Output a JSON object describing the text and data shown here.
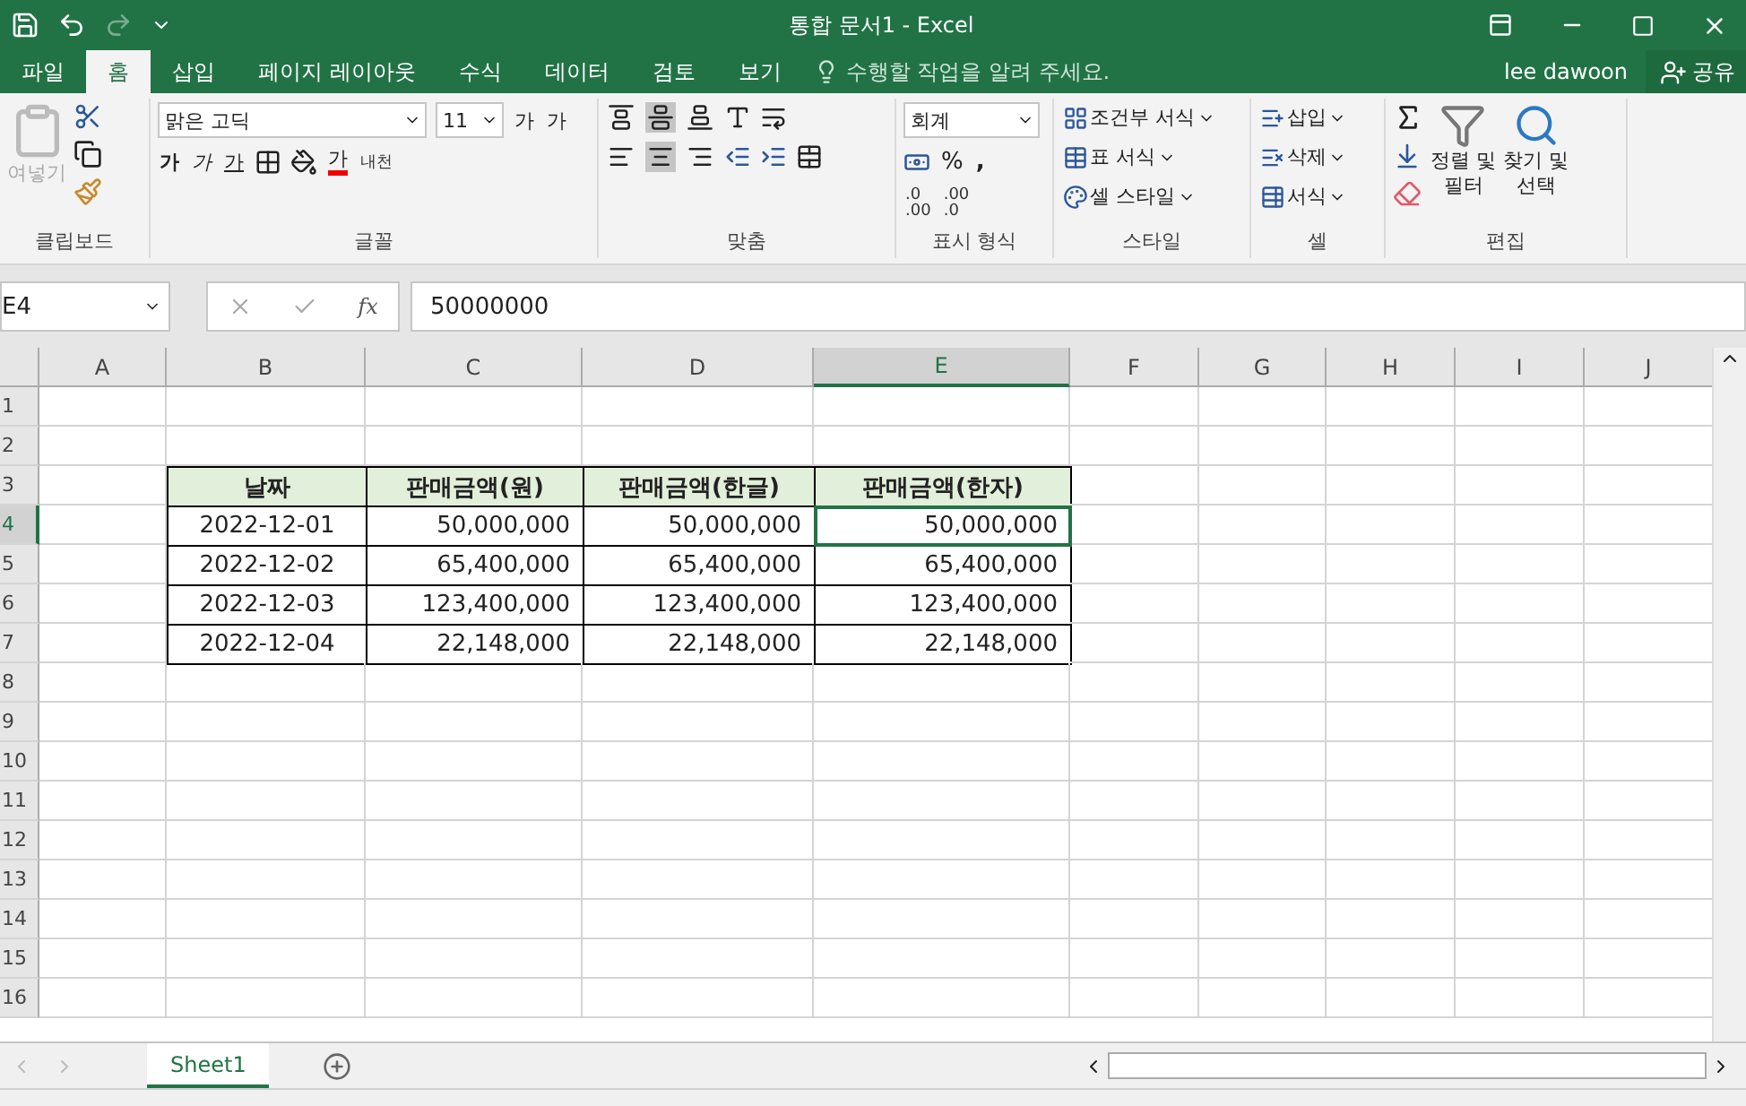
{
  "title_bar": {
    "title": "통합 문서1 - Excel",
    "redo_disabled": true
  },
  "menu_tabs": [
    {
      "label": "파일",
      "selected": false
    },
    {
      "label": "홈",
      "selected": true
    },
    {
      "label": "삽입",
      "selected": false
    },
    {
      "label": "페이지 레이아웃",
      "selected": false
    },
    {
      "label": "수식",
      "selected": false
    },
    {
      "label": "데이터",
      "selected": false
    },
    {
      "label": "검토",
      "selected": false
    },
    {
      "label": "보기",
      "selected": false
    }
  ],
  "tell_me": {
    "placeholder": "수행할 작업을 알려 주세요."
  },
  "user": "lee dawoon",
  "share": "공유",
  "ribbon": {
    "clipboard": {
      "paste": "여넣기",
      "label": "클립보드"
    },
    "font": {
      "label": "글꼴",
      "font_name": "맑은 고딕",
      "font_size": "11",
      "grow": "가",
      "shrink": "가",
      "bold": "가",
      "italic": "가",
      "underline": "가",
      "font_color": "가",
      "phonetic": "내천"
    },
    "alignment": {
      "label": "맞춤",
      "vertical": [
        {
          "selected": false
        },
        {
          "selected": true
        },
        {
          "selected": false
        }
      ],
      "horizontal": [
        {
          "selected": false
        },
        {
          "selected": true
        },
        {
          "selected": false
        }
      ]
    },
    "number": {
      "label": "표시 형식",
      "format": "회계",
      "percent": "%",
      "comma": ",",
      "decimals": [
        {
          "top": ".0",
          "bottom": ".00"
        },
        {
          "top": ".00",
          "bottom": ".0"
        }
      ]
    },
    "styles": {
      "label": "스타일",
      "items": [
        "조건부 서식",
        "표 서식",
        "셀 스타일"
      ]
    },
    "cells": {
      "label": "셀",
      "items": [
        "삽입",
        "삭제",
        "서식"
      ]
    },
    "editing": {
      "label": "편집",
      "sort": [
        "정렬 및",
        "필터"
      ],
      "find": [
        "찾기 및",
        "선택"
      ]
    }
  },
  "formula_bar": {
    "name_box": "E4",
    "fx": "fx",
    "value": "50000000"
  },
  "sheet": {
    "columns": [
      {
        "label": "A",
        "selected": false
      },
      {
        "label": "B",
        "selected": false
      },
      {
        "label": "C",
        "selected": false
      },
      {
        "label": "D",
        "selected": false
      },
      {
        "label": "E",
        "selected": true
      },
      {
        "label": "F",
        "selected": false
      },
      {
        "label": "G",
        "selected": false
      },
      {
        "label": "H",
        "selected": false
      },
      {
        "label": "I",
        "selected": false
      },
      {
        "label": "J",
        "selected": false
      }
    ],
    "rows": [
      {
        "label": "1",
        "selected": false,
        "cells": []
      },
      {
        "label": "2",
        "selected": false,
        "cells": []
      },
      {
        "label": "3",
        "selected": false,
        "cells": [
          {
            "text": ""
          },
          {
            "kind": "header",
            "text": "날짜",
            "selected": false
          },
          {
            "kind": "header",
            "text": "판매금액(원)",
            "selected": false
          },
          {
            "kind": "header",
            "text": "판매금액(한글)",
            "selected": false
          },
          {
            "kind": "header",
            "text": "판매금액(한자)",
            "selected": false
          }
        ]
      },
      {
        "label": "4",
        "selected": true,
        "cells": [
          {
            "text": ""
          },
          {
            "kind": "date",
            "text": "2022-12-01",
            "selected": false
          },
          {
            "kind": "number",
            "text": "50,000,000",
            "selected": false
          },
          {
            "kind": "number",
            "text": "50,000,000",
            "selected": false
          },
          {
            "kind": "number",
            "text": "50,000,000",
            "selected": true
          }
        ]
      },
      {
        "label": "5",
        "selected": false,
        "cells": [
          {
            "text": ""
          },
          {
            "kind": "date",
            "text": "2022-12-02",
            "selected": false
          },
          {
            "kind": "number",
            "text": "65,400,000",
            "selected": false
          },
          {
            "kind": "number",
            "text": "65,400,000",
            "selected": false
          },
          {
            "kind": "number",
            "text": "65,400,000",
            "selected": false
          }
        ]
      },
      {
        "label": "6",
        "selected": false,
        "cells": [
          {
            "text": ""
          },
          {
            "kind": "date",
            "text": "2022-12-03",
            "selected": false
          },
          {
            "kind": "number",
            "text": "123,400,000",
            "selected": false
          },
          {
            "kind": "number",
            "text": "123,400,000",
            "selected": false
          },
          {
            "kind": "number",
            "text": "123,400,000",
            "selected": false
          }
        ]
      },
      {
        "label": "7",
        "selected": false,
        "cells": [
          {
            "text": ""
          },
          {
            "kind": "date",
            "text": "2022-12-04",
            "selected": false
          },
          {
            "kind": "number",
            "text": "22,148,000",
            "selected": false
          },
          {
            "kind": "number",
            "text": "22,148,000",
            "selected": false
          },
          {
            "kind": "number",
            "text": "22,148,000",
            "selected": false
          }
        ]
      },
      {
        "label": "8",
        "selected": false,
        "cells": []
      },
      {
        "label": "9",
        "selected": false,
        "cells": []
      },
      {
        "label": "10",
        "selected": false,
        "cells": []
      },
      {
        "label": "11",
        "selected": false,
        "cells": []
      },
      {
        "label": "12",
        "selected": false,
        "cells": []
      },
      {
        "label": "13",
        "selected": false,
        "cells": []
      },
      {
        "label": "14",
        "selected": false,
        "cells": []
      },
      {
        "label": "15",
        "selected": false,
        "cells": []
      },
      {
        "label": "16",
        "selected": false,
        "cells": []
      }
    ]
  },
  "sheet_tabs": [
    {
      "label": "Sheet1",
      "selected": true
    }
  ]
}
